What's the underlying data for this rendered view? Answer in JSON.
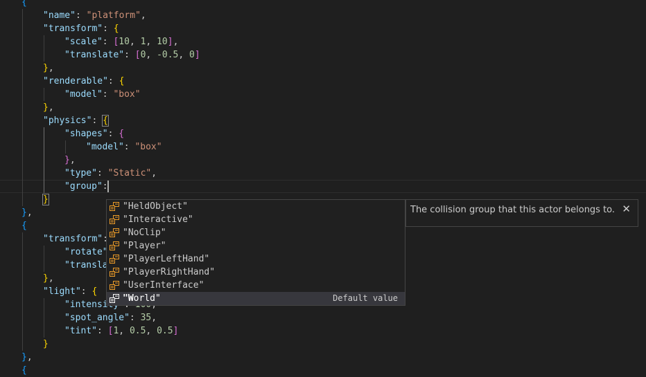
{
  "editor": {
    "lines": [
      {
        "indent": 1,
        "tokens": [
          {
            "t": "{",
            "c": "b3"
          }
        ]
      },
      {
        "indent": 2,
        "tokens": [
          {
            "t": "\"name\"",
            "c": "key"
          },
          {
            "t": ": ",
            "c": "punc"
          },
          {
            "t": "\"platform\"",
            "c": "str"
          },
          {
            "t": ",",
            "c": "punc"
          }
        ]
      },
      {
        "indent": 2,
        "tokens": [
          {
            "t": "\"transform\"",
            "c": "key"
          },
          {
            "t": ": ",
            "c": "punc"
          },
          {
            "t": "{",
            "c": "b1"
          }
        ]
      },
      {
        "indent": 3,
        "tokens": [
          {
            "t": "\"scale\"",
            "c": "key"
          },
          {
            "t": ": ",
            "c": "punc"
          },
          {
            "t": "[",
            "c": "b2"
          },
          {
            "t": "10",
            "c": "num"
          },
          {
            "t": ", ",
            "c": "punc"
          },
          {
            "t": "1",
            "c": "num"
          },
          {
            "t": ", ",
            "c": "punc"
          },
          {
            "t": "10",
            "c": "num"
          },
          {
            "t": "]",
            "c": "b2"
          },
          {
            "t": ",",
            "c": "punc"
          }
        ]
      },
      {
        "indent": 3,
        "tokens": [
          {
            "t": "\"translate\"",
            "c": "key"
          },
          {
            "t": ": ",
            "c": "punc"
          },
          {
            "t": "[",
            "c": "b2"
          },
          {
            "t": "0",
            "c": "num"
          },
          {
            "t": ", ",
            "c": "punc"
          },
          {
            "t": "-0.5",
            "c": "num"
          },
          {
            "t": ", ",
            "c": "punc"
          },
          {
            "t": "0",
            "c": "num"
          },
          {
            "t": "]",
            "c": "b2"
          }
        ]
      },
      {
        "indent": 2,
        "tokens": [
          {
            "t": "}",
            "c": "b1"
          },
          {
            "t": ",",
            "c": "punc"
          }
        ]
      },
      {
        "indent": 2,
        "tokens": [
          {
            "t": "\"renderable\"",
            "c": "key"
          },
          {
            "t": ": ",
            "c": "punc"
          },
          {
            "t": "{",
            "c": "b1"
          }
        ]
      },
      {
        "indent": 3,
        "tokens": [
          {
            "t": "\"model\"",
            "c": "key"
          },
          {
            "t": ": ",
            "c": "punc"
          },
          {
            "t": "\"box\"",
            "c": "str"
          }
        ]
      },
      {
        "indent": 2,
        "tokens": [
          {
            "t": "}",
            "c": "b1"
          },
          {
            "t": ",",
            "c": "punc"
          }
        ]
      },
      {
        "indent": 2,
        "tokens": [
          {
            "t": "\"physics\"",
            "c": "key"
          },
          {
            "t": ": ",
            "c": "punc"
          },
          {
            "t": "{",
            "c": "b1",
            "boxed": true
          }
        ]
      },
      {
        "indent": 3,
        "tokens": [
          {
            "t": "\"shapes\"",
            "c": "key"
          },
          {
            "t": ": ",
            "c": "punc"
          },
          {
            "t": "{",
            "c": "b2"
          }
        ]
      },
      {
        "indent": 4,
        "tokens": [
          {
            "t": "\"model\"",
            "c": "key"
          },
          {
            "t": ": ",
            "c": "punc"
          },
          {
            "t": "\"box\"",
            "c": "str"
          }
        ]
      },
      {
        "indent": 3,
        "tokens": [
          {
            "t": "}",
            "c": "b2"
          },
          {
            "t": ",",
            "c": "punc"
          }
        ]
      },
      {
        "indent": 3,
        "tokens": [
          {
            "t": "\"type\"",
            "c": "key"
          },
          {
            "t": ": ",
            "c": "punc"
          },
          {
            "t": "\"Static\"",
            "c": "str"
          },
          {
            "t": ",",
            "c": "punc"
          }
        ]
      },
      {
        "indent": 3,
        "current": true,
        "tokens": [
          {
            "t": "\"group\"",
            "c": "key"
          },
          {
            "t": ":",
            "c": "punc"
          }
        ]
      },
      {
        "indent": 2,
        "tokens": [
          {
            "t": "}",
            "c": "b1",
            "boxed": true
          }
        ]
      },
      {
        "indent": 1,
        "tokens": [
          {
            "t": "}",
            "c": "b3"
          },
          {
            "t": ",",
            "c": "punc"
          }
        ]
      },
      {
        "indent": 1,
        "tokens": [
          {
            "t": "{",
            "c": "b3"
          }
        ]
      },
      {
        "indent": 2,
        "tokens": [
          {
            "t": "\"transform\"",
            "c": "key"
          },
          {
            "t": ": ",
            "c": "punc"
          },
          {
            "t": "{",
            "c": "b1"
          }
        ]
      },
      {
        "indent": 3,
        "tokens": [
          {
            "t": "\"rotate\"",
            "c": "key"
          }
        ]
      },
      {
        "indent": 3,
        "tokens": [
          {
            "t": "\"transla",
            "c": "key"
          }
        ]
      },
      {
        "indent": 2,
        "tokens": [
          {
            "t": "}",
            "c": "b1"
          },
          {
            "t": ",",
            "c": "punc"
          }
        ]
      },
      {
        "indent": 2,
        "tokens": [
          {
            "t": "\"light\"",
            "c": "key"
          },
          {
            "t": ": ",
            "c": "punc"
          },
          {
            "t": "{",
            "c": "b1"
          }
        ]
      },
      {
        "indent": 3,
        "tokens": [
          {
            "t": "\"intensity\"",
            "c": "key"
          },
          {
            "t": ": ",
            "c": "punc"
          },
          {
            "t": "100",
            "c": "num"
          },
          {
            "t": ",",
            "c": "punc"
          }
        ]
      },
      {
        "indent": 3,
        "tokens": [
          {
            "t": "\"spot_angle\"",
            "c": "key"
          },
          {
            "t": ": ",
            "c": "punc"
          },
          {
            "t": "35",
            "c": "num"
          },
          {
            "t": ",",
            "c": "punc"
          }
        ]
      },
      {
        "indent": 3,
        "tokens": [
          {
            "t": "\"tint\"",
            "c": "key"
          },
          {
            "t": ": ",
            "c": "punc"
          },
          {
            "t": "[",
            "c": "b2"
          },
          {
            "t": "1",
            "c": "num"
          },
          {
            "t": ", ",
            "c": "punc"
          },
          {
            "t": "0.5",
            "c": "num"
          },
          {
            "t": ", ",
            "c": "punc"
          },
          {
            "t": "0.5",
            "c": "num"
          },
          {
            "t": "]",
            "c": "b2"
          }
        ]
      },
      {
        "indent": 2,
        "tokens": [
          {
            "t": "}",
            "c": "b1"
          }
        ]
      },
      {
        "indent": 1,
        "tokens": [
          {
            "t": "}",
            "c": "b3"
          },
          {
            "t": ",",
            "c": "punc"
          }
        ]
      },
      {
        "indent": 1,
        "tokens": [
          {
            "t": "{",
            "c": "b3"
          }
        ]
      }
    ]
  },
  "suggest": {
    "icon": "enum-member-icon",
    "items": [
      {
        "label": "\"HeldObject\"",
        "detail": ""
      },
      {
        "label": "\"Interactive\"",
        "detail": ""
      },
      {
        "label": "\"NoClip\"",
        "detail": ""
      },
      {
        "label": "\"Player\"",
        "detail": ""
      },
      {
        "label": "\"PlayerLeftHand\"",
        "detail": ""
      },
      {
        "label": "\"PlayerRightHand\"",
        "detail": ""
      },
      {
        "label": "\"UserInterface\"",
        "detail": ""
      },
      {
        "label": "\"World\"",
        "detail": "Default value",
        "selected": true
      }
    ]
  },
  "details": {
    "text": "The collision group that this actor belongs to.",
    "close_glyph": "✕"
  },
  "colors": {
    "background": "#1f1f1f",
    "key": "#9cdcfe",
    "string": "#ce9178",
    "number": "#b5cea8",
    "bracket1": "#ffd700",
    "bracket2": "#da70d6",
    "bracket3": "#179fff",
    "enum_icon": "#ee9d28"
  }
}
